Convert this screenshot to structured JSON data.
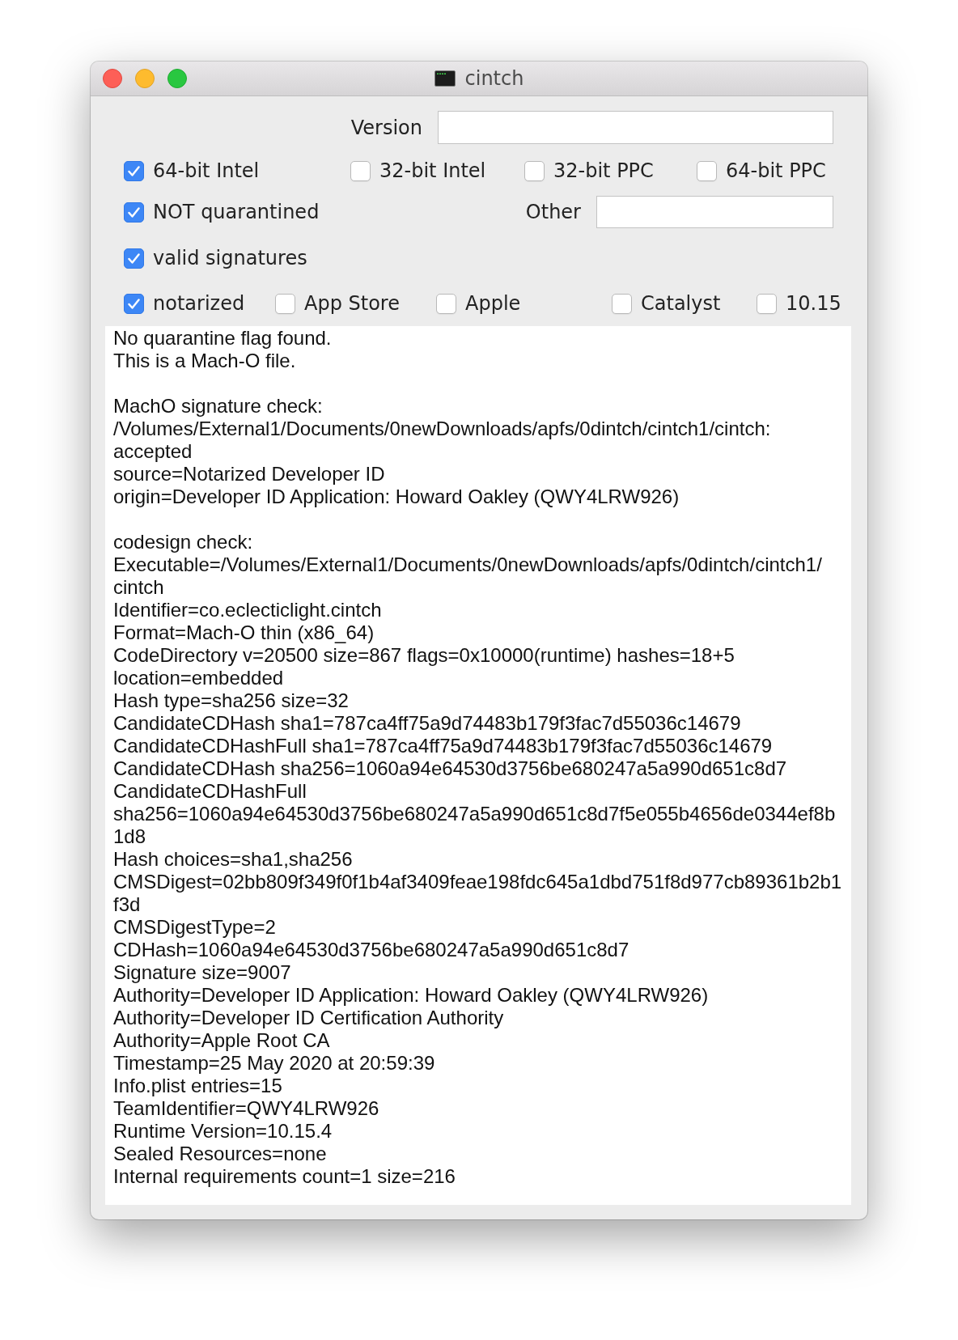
{
  "window": {
    "title": "cintch"
  },
  "version_field": {
    "label": "Version"
  },
  "architectures": [
    {
      "label": "64-bit Intel",
      "checked": true
    },
    {
      "label": "32-bit Intel",
      "checked": false
    },
    {
      "label": "32-bit PPC",
      "checked": false
    },
    {
      "label": "64-bit PPC",
      "checked": false
    }
  ],
  "quarantine": {
    "label": "NOT quarantined",
    "checked": true
  },
  "other_field": {
    "label": "Other"
  },
  "signatures": {
    "label": "valid signatures",
    "checked": true
  },
  "sources": [
    {
      "label": "notarized",
      "checked": true
    },
    {
      "label": "App Store",
      "checked": false
    },
    {
      "label": "Apple",
      "checked": false
    },
    {
      "label": "Catalyst",
      "checked": false
    },
    {
      "label": "10.15",
      "checked": false
    }
  ],
  "output": [
    [
      "No quarantine flag found.",
      "This is a Mach-O file."
    ],
    [
      "MachO signature check:",
      "/Volumes/External1/Documents/0newDownloads/apfs/0dintch/cintch1/cintch:",
      "accepted",
      "source=Notarized Developer ID",
      "origin=Developer ID Application: Howard Oakley (QWY4LRW926)"
    ],
    [
      "codesign check:",
      "Executable=/Volumes/External1/Documents/0newDownloads/apfs/0dintch/cintch1/",
      "cintch",
      "Identifier=co.eclecticlight.cintch",
      "Format=Mach-O thin (x86_64)",
      "CodeDirectory v=20500 size=867 flags=0x10000(runtime) hashes=18+5",
      "location=embedded",
      "Hash type=sha256 size=32",
      "CandidateCDHash sha1=787ca4ff75a9d74483b179f3fac7d55036c14679",
      "CandidateCDHashFull sha1=787ca4ff75a9d74483b179f3fac7d55036c14679",
      "CandidateCDHash sha256=1060a94e64530d3756be680247a5a990d651c8d7",
      "CandidateCDHashFull",
      "sha256=1060a94e64530d3756be680247a5a990d651c8d7f5e055b4656de0344ef8b",
      "1d8",
      "Hash choices=sha1,sha256",
      "CMSDigest=02bb809f349f0f1b4af3409feae198fdc645a1dbd751f8d977cb89361b2b1",
      "f3d",
      "CMSDigestType=2",
      "CDHash=1060a94e64530d3756be680247a5a990d651c8d7",
      "Signature size=9007",
      "Authority=Developer ID Application: Howard Oakley (QWY4LRW926)",
      "Authority=Developer ID Certification Authority",
      "Authority=Apple Root CA",
      "Timestamp=25 May 2020 at 20:59:39",
      "Info.plist entries=15",
      "TeamIdentifier=QWY4LRW926",
      "Runtime Version=10.15.4",
      "Sealed Resources=none",
      "Internal requirements count=1 size=216"
    ]
  ]
}
